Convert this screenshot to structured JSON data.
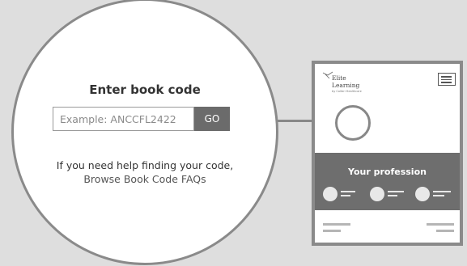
{
  "book_code": {
    "title": "Enter book code",
    "input_placeholder": "Example: ANCCFL2422",
    "go_label": "GO",
    "help_text": "If you need help finding your code,",
    "help_link": "Browse Book Code FAQs"
  },
  "device": {
    "logo_line1": "Elite",
    "logo_line2": "Learning",
    "logo_tagline": "by Colibri Healthcare",
    "band_title": "Your profession",
    "menu_icon": "hamburger-menu-icon"
  },
  "colors": {
    "background": "#dedede",
    "band": "#6e6e6e",
    "go_button": "#6b6b6b"
  }
}
